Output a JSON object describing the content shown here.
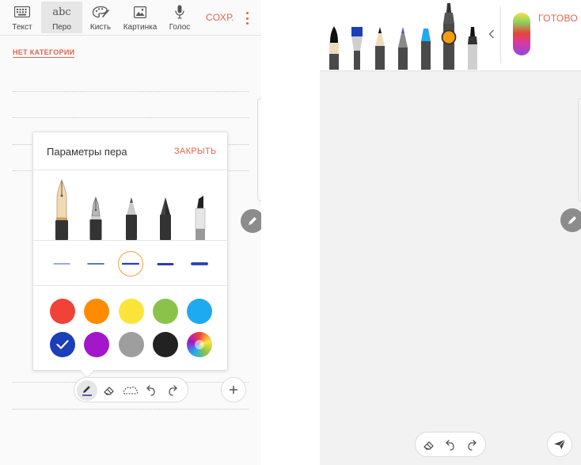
{
  "toolbar": {
    "tabs": [
      {
        "label": "Текст",
        "icon": "keyboard-icon"
      },
      {
        "label": "Перо",
        "icon": "abc-handwriting-icon",
        "active": true,
        "glyph": "abc"
      },
      {
        "label": "Кисть",
        "icon": "palette-icon"
      },
      {
        "label": "Картинка",
        "icon": "image-icon"
      },
      {
        "label": "Голос",
        "icon": "microphone-icon"
      }
    ],
    "save_label": "СОХР."
  },
  "note": {
    "category_label": "НЕТ КАТЕГОРИИ"
  },
  "pen_settings": {
    "title": "Параметры пера",
    "close_label": "ЗАКРЫТЬ",
    "pen_types": [
      "fountain-pen",
      "calligraphy-pen",
      "pencil",
      "brush-pen",
      "marker"
    ],
    "selected_pen": "fountain-pen",
    "thickness_levels": 5,
    "selected_thickness": 3,
    "colors": [
      "#f04237",
      "#ff8c00",
      "#fbe43a",
      "#8bc34a",
      "#1eaaf1",
      "#1a3fb8",
      "#a117c9",
      "#9e9e9e",
      "#222222",
      "rainbow"
    ],
    "selected_color": "#1a3fb8"
  },
  "bottom_tools": [
    "pen-tool",
    "eraser-tool",
    "lasso-tool",
    "undo",
    "redo"
  ],
  "right": {
    "pens": [
      {
        "type": "brush",
        "tip": "#111111"
      },
      {
        "type": "flat-brush",
        "tip": "#1a3fb8"
      },
      {
        "type": "pencil",
        "tip": "#111111"
      },
      {
        "type": "brush-pen",
        "tip": "#7b3fc4"
      },
      {
        "type": "crayon",
        "tip": "#1eaaf1"
      },
      {
        "type": "marker",
        "tip": "#f39c12",
        "selected": true
      },
      {
        "type": "fineliner",
        "tip": "#111111"
      }
    ],
    "done_label": "ГОТОВО"
  },
  "accent": "#e8624c"
}
